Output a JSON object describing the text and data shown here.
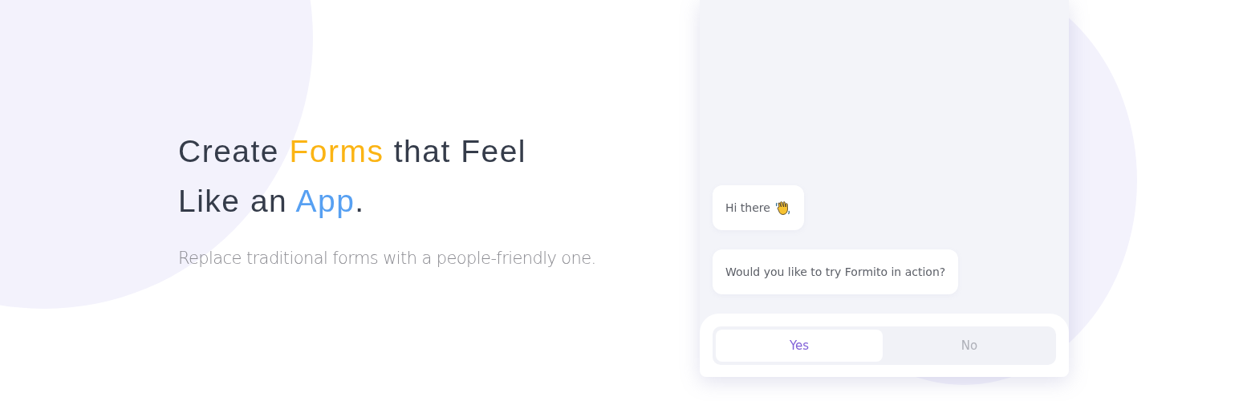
{
  "hero": {
    "headline_lines": [
      [
        {
          "text": "Create ",
          "color": "#353c4a"
        },
        {
          "text": "Forms",
          "color": "#fbb414"
        },
        {
          "text": " that Feel",
          "color": "#353c4a"
        }
      ],
      [
        {
          "text": "Like an ",
          "color": "#353c4a"
        },
        {
          "text": "App",
          "color": "#57a0f2"
        },
        {
          "text": ".",
          "color": "#353c4a"
        }
      ]
    ],
    "subtitle": "Replace traditional forms with a people-friendly one."
  },
  "chat": {
    "messages": [
      {
        "text": "Hi there",
        "kind": "wave"
      },
      {
        "text": "Would you like to try Formito in action?",
        "kind": "plain"
      }
    ],
    "choices": [
      {
        "label": "Yes",
        "selected": true
      },
      {
        "label": "No",
        "selected": false
      }
    ]
  }
}
